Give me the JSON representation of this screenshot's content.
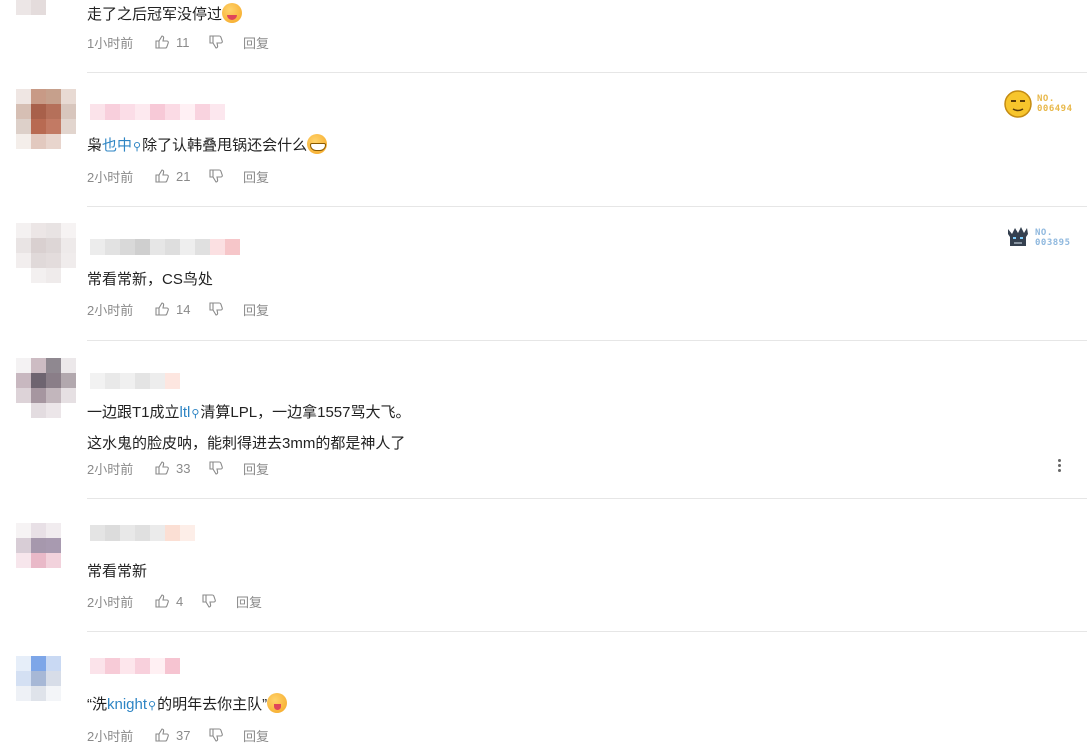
{
  "comments": [
    {
      "text_parts": [
        "走了之后冠军没停过"
      ],
      "time": "1小时前",
      "likes": "11",
      "reply": "回复",
      "emoji": "drooling-face"
    },
    {
      "text_parts": [
        "枭",
        "也中",
        "除了认韩叠甩锅还会什么"
      ],
      "time": "2小时前",
      "likes": "21",
      "reply": "回复",
      "emoji": "grinning-face",
      "badge": {
        "label": "NO.",
        "number": "006494",
        "color": "#e8b84a",
        "icon": "yellow-face-icon"
      }
    },
    {
      "text_parts": [
        "常看常新，CS鸟处"
      ],
      "time": "2小时前",
      "likes": "14",
      "reply": "回复",
      "badge": {
        "label": "NO.",
        "number": "003895",
        "color": "#8fb8de",
        "icon": "character-icon"
      }
    },
    {
      "text_parts": [
        "一边跟T1成立",
        "ltl",
        "清算LPL，一边拿1557骂大飞。",
        "这水鬼的脸皮呐，能刺得进去3mm的都是神人了"
      ],
      "time": "2小时前",
      "likes": "33",
      "reply": "回复"
    },
    {
      "text_parts": [
        "常看常新"
      ],
      "time": "2小时前",
      "likes": "4",
      "reply": "回复"
    },
    {
      "text_parts": [
        "“洗",
        "knight",
        "的明年去你主队”"
      ],
      "time": "2小时前",
      "likes": "37",
      "reply": "回复",
      "emoji": "winking-face"
    }
  ],
  "colors": {
    "link": "#2e85c4",
    "meta": "#8a8a8a",
    "divider": "#e6e6e6"
  }
}
